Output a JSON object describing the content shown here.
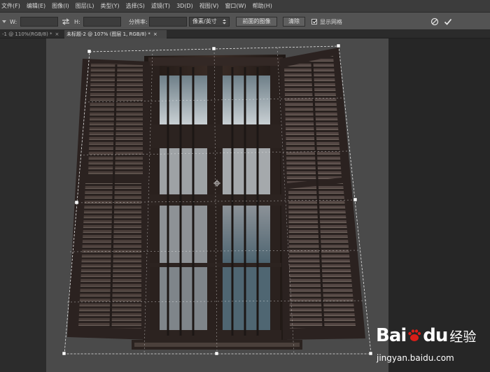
{
  "menu": [
    "文件(F)",
    "编辑(E)",
    "图像(I)",
    "图层(L)",
    "类型(Y)",
    "选择(S)",
    "滤镜(T)",
    "3D(D)",
    "视图(V)",
    "窗口(W)",
    "帮助(H)"
  ],
  "options": {
    "w_label": "W:",
    "h_label": "H:",
    "w_value": "",
    "h_value": "",
    "resolution_label": "分辨率:",
    "resolution_value": "",
    "unit_select": "像素/英寸",
    "front_image_button": "前面的图像",
    "clear_button": "清除",
    "show_grid_label": "显示网格"
  },
  "tabs": [
    {
      "label": "-1 @ 110%(RGB/8) *",
      "close": "×"
    },
    {
      "label": "未标题-2 @ 107% (图层 1, RGB/8) *",
      "close": "×"
    }
  ],
  "watermark": {
    "logo": "Bai",
    "logo_suffix": "du",
    "logo_cn": "经验",
    "url": "jingyan.baidu.com"
  },
  "colors": {
    "accent": "#3c3c3c",
    "canvas": "#4a4a4a",
    "wood": "#2b211d"
  }
}
